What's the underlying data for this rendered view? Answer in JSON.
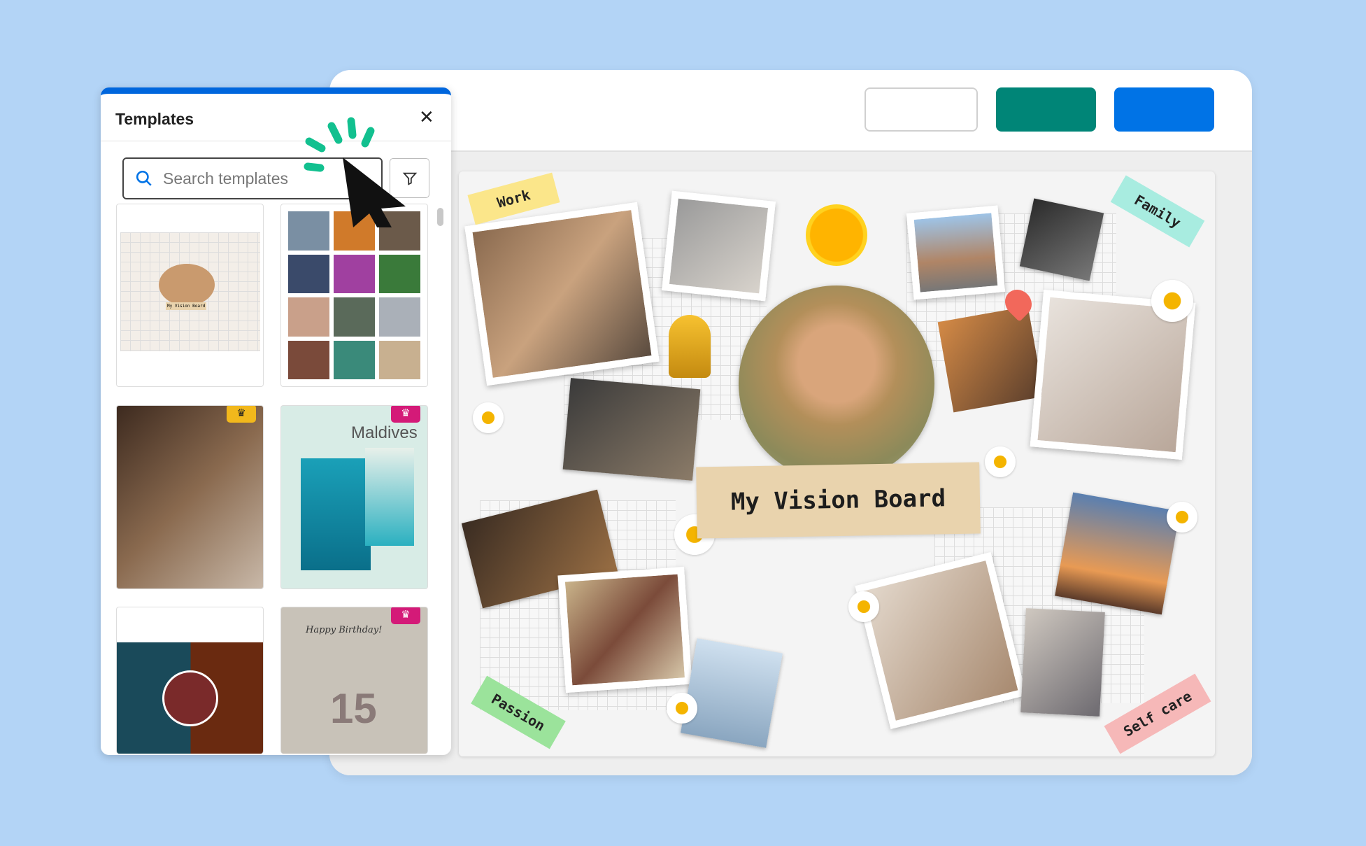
{
  "colors": {
    "background": "#b3d4f6",
    "accent_blue": "#0073e6",
    "accent_teal": "#008577",
    "crown_gold": "#f2b81c",
    "crown_pink": "#d41a78",
    "spark": "#12c08f"
  },
  "toolbar": {
    "buttons": [
      {
        "label": ""
      },
      {
        "label": ""
      },
      {
        "label": ""
      }
    ]
  },
  "panel": {
    "title": "Templates",
    "close_icon": "close-icon",
    "search": {
      "placeholder": "Search templates",
      "value": ""
    },
    "filter_icon": "filter-icon",
    "templates": [
      {
        "name": "vision-board",
        "premium": false,
        "text": "My Vision Board"
      },
      {
        "name": "portrait-grid",
        "premium": false,
        "text": ""
      },
      {
        "name": "brown-moodboard",
        "premium": true,
        "crown": "gold",
        "text": ""
      },
      {
        "name": "maldives",
        "premium": true,
        "crown": "pink",
        "text": "Maldives"
      },
      {
        "name": "ocean-fire",
        "premium": false,
        "text": ""
      },
      {
        "name": "birthday",
        "premium": true,
        "crown": "pink",
        "text": "Happy Birthday!",
        "number": "15"
      }
    ]
  },
  "board": {
    "title": "My Vision Board",
    "labels": {
      "work": "Work",
      "family": "Family",
      "passion": "Passion",
      "self_care": "Self care"
    }
  }
}
